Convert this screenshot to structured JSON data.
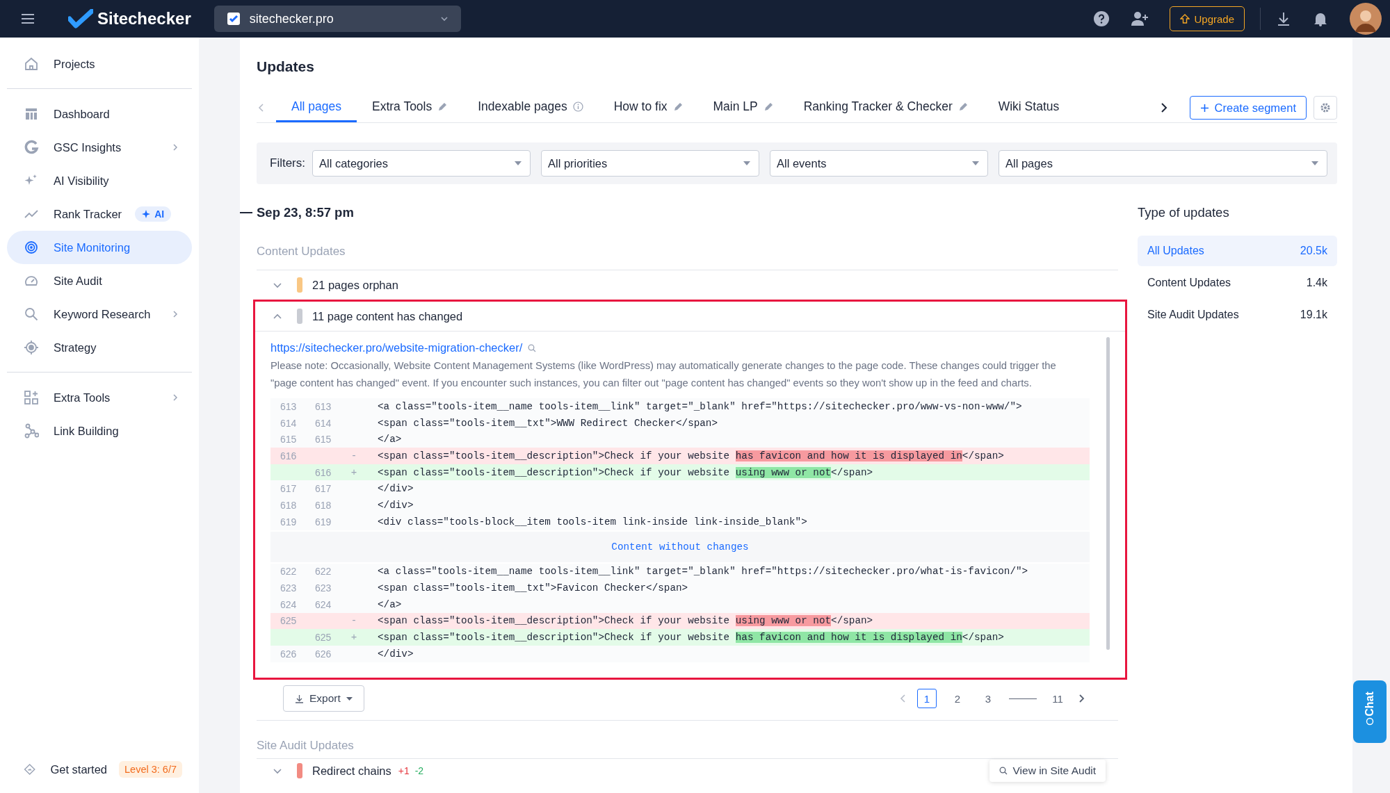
{
  "topbar": {
    "brand": "Sitechecker",
    "project": "sitechecker.pro",
    "upgrade": "Upgrade"
  },
  "sidebar": {
    "sections": [
      {
        "items": [
          {
            "label": "Projects",
            "selected": false,
            "expandable": false
          }
        ]
      },
      {
        "items": [
          {
            "label": "Dashboard",
            "selected": false,
            "expandable": false
          },
          {
            "label": "GSC Insights",
            "selected": false,
            "expandable": true
          },
          {
            "label": "AI Visibility",
            "selected": false,
            "expandable": false
          },
          {
            "label": "Rank Tracker",
            "selected": false,
            "expandable": false,
            "badge": "AI"
          },
          {
            "label": "Site Monitoring",
            "selected": true,
            "expandable": false
          },
          {
            "label": "Site Audit",
            "selected": false,
            "expandable": false
          },
          {
            "label": "Keyword Research",
            "selected": false,
            "expandable": true
          },
          {
            "label": "Strategy",
            "selected": false,
            "expandable": false
          }
        ]
      },
      {
        "items": [
          {
            "label": "Extra Tools",
            "selected": false,
            "expandable": true
          },
          {
            "label": "Link Building",
            "selected": false,
            "expandable": false
          }
        ]
      }
    ],
    "footer": {
      "label": "Get started",
      "badge": "Level 3: 6/7"
    }
  },
  "page": {
    "title": "Updates"
  },
  "tabs": [
    {
      "label": "All pages",
      "selected": true,
      "kind": "plain"
    },
    {
      "label": "Extra Tools",
      "selected": false,
      "kind": "editable"
    },
    {
      "label": "Indexable pages",
      "selected": false,
      "kind": "info"
    },
    {
      "label": "How to fix",
      "selected": false,
      "kind": "editable"
    },
    {
      "label": "Main LP",
      "selected": false,
      "kind": "editable"
    },
    {
      "label": "Ranking Tracker & Checker",
      "selected": false,
      "kind": "editable"
    },
    {
      "label": "Wiki Status",
      "selected": false,
      "kind": "plain"
    }
  ],
  "create_segment": "Create segment",
  "filters": {
    "label": "Filters:",
    "dropdowns": [
      "All categories",
      "All priorities",
      "All events",
      "All pages"
    ]
  },
  "date": "Sep 23, 8:57 pm",
  "content_updates": {
    "title": "Content Updates",
    "rows": [
      {
        "label": "21 pages orphan",
        "expanded": false,
        "color": "#f9c784"
      },
      {
        "label": "11 page content has changed",
        "expanded": true,
        "color": "#c9ccd3"
      }
    ]
  },
  "detail": {
    "url": "https://sitechecker.pro/website-migration-checker/",
    "note": "Please note: Occasionally, Website Content Management Systems (like WordPress) may automatically generate changes to the page code. These changes could trigger the \"page content has changed\" event. If you encounter such instances, you can filter out \"page content has changed\" events so they won't show up in the feed and charts.",
    "lines": [
      {
        "kind": "context",
        "old": "613",
        "new": "613",
        "code": "<a class=\"tools-item__name tools-item__link\" target=\"_blank\" href=\"https://sitechecker.pro/www-vs-non-www/\">"
      },
      {
        "kind": "context",
        "old": "614",
        "new": "614",
        "code": "<span class=\"tools-item__txt\">WWW Redirect Checker</span>"
      },
      {
        "kind": "context",
        "old": "615",
        "new": "615",
        "code": "</a>"
      },
      {
        "kind": "removed",
        "old": "616",
        "sign": "-",
        "before": "<span class=\"tools-item__description\">Check if your website ",
        "highlight": "has favicon and how it is displayed in",
        "after": "</span>"
      },
      {
        "kind": "added",
        "new": "616",
        "sign": "+",
        "before": "<span class=\"tools-item__description\">Check if your website ",
        "highlight": "using www or not",
        "after": "</span>"
      },
      {
        "kind": "context",
        "old": "617",
        "new": "617",
        "code": "</div>"
      },
      {
        "kind": "context",
        "old": "618",
        "new": "618",
        "code": "</div>"
      },
      {
        "kind": "context",
        "old": "619",
        "new": "619",
        "code": "<div class=\"tools-block__item tools-item link-inside link-inside_blank\">"
      },
      {
        "kind": "collapsed",
        "code": "Content without changes"
      },
      {
        "kind": "context",
        "old": "622",
        "new": "622",
        "code": "<a class=\"tools-item__name tools-item__link\" target=\"_blank\" href=\"https://sitechecker.pro/what-is-favicon/\">"
      },
      {
        "kind": "context",
        "old": "623",
        "new": "623",
        "code": "<span class=\"tools-item__txt\">Favicon Checker</span>"
      },
      {
        "kind": "context",
        "old": "624",
        "new": "624",
        "code": "</a>"
      },
      {
        "kind": "removed",
        "old": "625",
        "sign": "-",
        "before": "<span class=\"tools-item__description\">Check if your website ",
        "highlight": "using www or not",
        "after": "</span>"
      },
      {
        "kind": "added",
        "new": "625",
        "sign": "+",
        "before": "<span class=\"tools-item__description\">Check if your website ",
        "highlight": "has favicon and how it is displayed in",
        "after": "</span>"
      },
      {
        "kind": "context",
        "old": "626",
        "new": "626",
        "code": "</div>"
      }
    ]
  },
  "export": "Export",
  "pagination": [
    {
      "label": "1",
      "selected": true
    },
    {
      "label": "2",
      "selected": false
    },
    {
      "label": "3",
      "selected": false
    },
    {
      "label": "11",
      "selected": false
    }
  ],
  "site_audit_updates": {
    "title": "Site Audit Updates",
    "row": {
      "label": "Redirect chains",
      "color": "#f28b82",
      "added": "+1",
      "removed": "-2",
      "action": "View in Site Audit"
    }
  },
  "type_of_updates": {
    "title": "Type of updates",
    "items": [
      {
        "label": "All Updates",
        "count": "20.5k",
        "selected": true
      },
      {
        "label": "Content Updates",
        "count": "1.4k",
        "selected": false
      },
      {
        "label": "Site Audit Updates",
        "count": "19.1k",
        "selected": false
      }
    ]
  },
  "chat": "Chat"
}
